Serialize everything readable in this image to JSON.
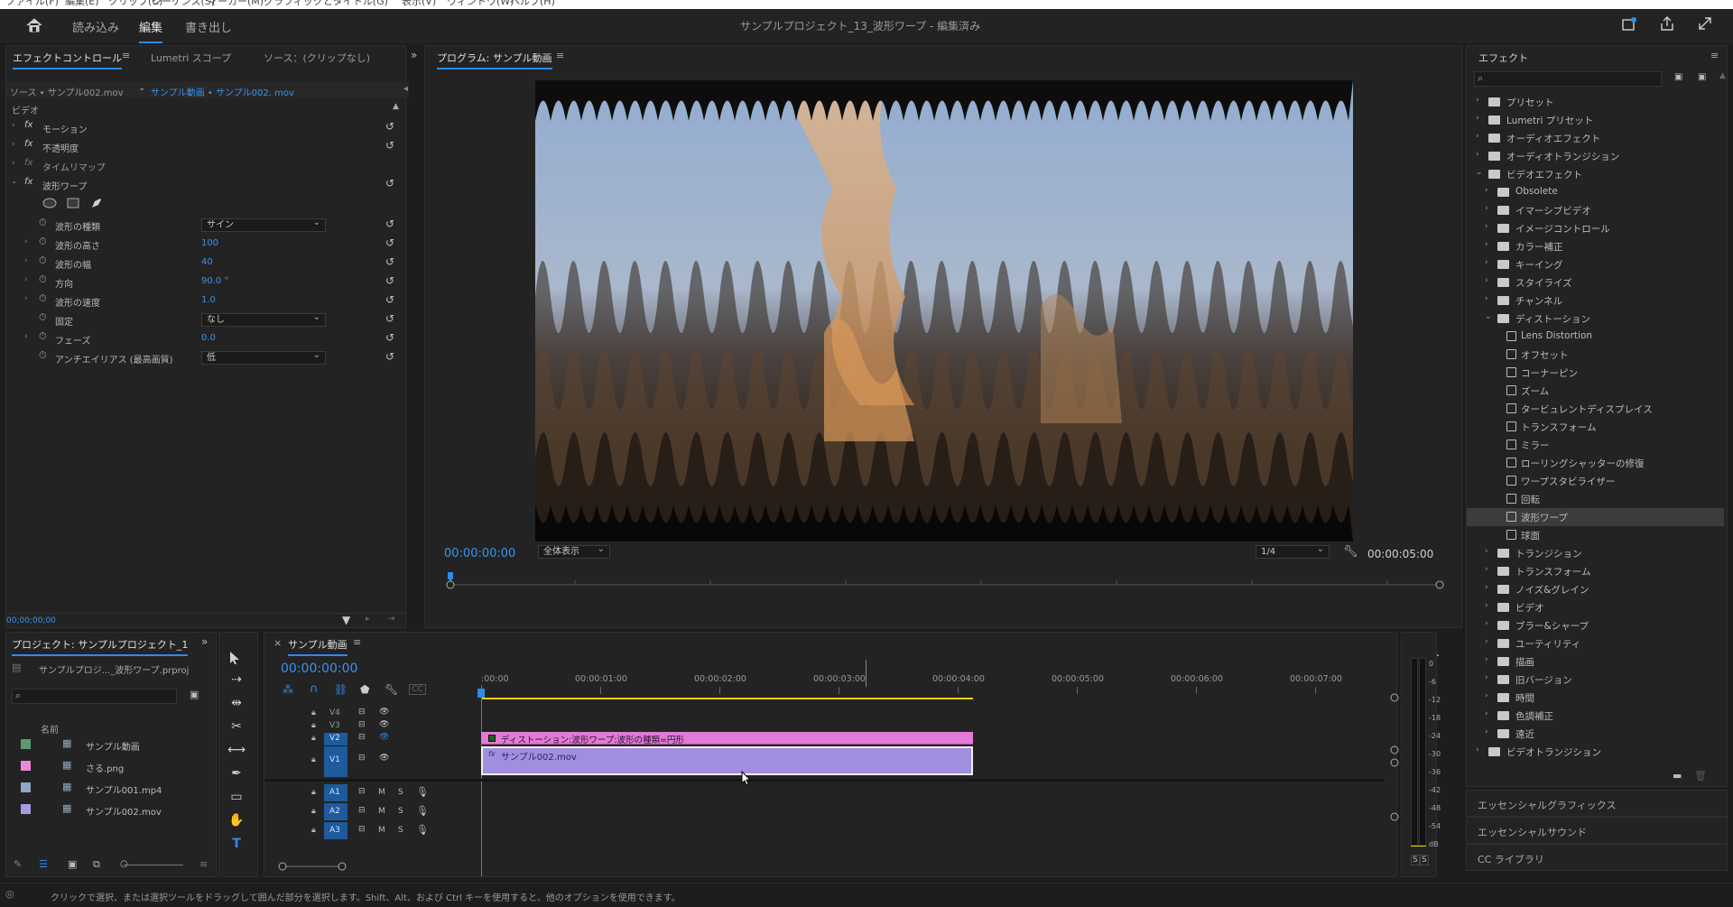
{
  "app": {
    "window_title": "サンプルプロジェクト_13_波形ワープ - 編集済み",
    "menu": [
      "ファイル(F)",
      "編集(E)",
      "クリップ(C)",
      "シーケンス(S)",
      "マーカー(M)",
      "グラフィックとタイトル(G)",
      "表示(V)",
      "ウィンドウ(W)",
      "ヘルプ(H)"
    ],
    "workspaces": [
      "読み込み",
      "編集",
      "書き出し"
    ],
    "active_workspace": "編集"
  },
  "effect_controls": {
    "tabs": [
      "エフェクトコントロール",
      "Lumetri スコープ",
      "ソース：(クリップなし)"
    ],
    "source_label": "ソース • サンプル002.mov",
    "target_label": "サンプル動画 • サンプル002. mov",
    "section": "ビデオ",
    "effects": [
      "モーション",
      "不透明度",
      "タイムリマップ",
      "波形ワープ"
    ],
    "params": [
      {
        "name": "波形の種類",
        "value": "サイン",
        "kind": "dropdown"
      },
      {
        "name": "波形の高さ",
        "value": "100",
        "kind": "number"
      },
      {
        "name": "波形の幅",
        "value": "40",
        "kind": "number"
      },
      {
        "name": "方向",
        "value": "90.0 °",
        "kind": "number"
      },
      {
        "name": "波形の速度",
        "value": "1.0",
        "kind": "number"
      },
      {
        "name": "固定",
        "value": "なし",
        "kind": "dropdown"
      },
      {
        "name": "フェーズ",
        "value": "0.0",
        "kind": "number"
      },
      {
        "name": "アンチエイリアス (最高画質)",
        "value": "低",
        "kind": "dropdown"
      }
    ],
    "footer_timecode": "00;00;00;00"
  },
  "program": {
    "title": "プログラム: サンプル動画",
    "timecode": "00:00:00:00",
    "zoom": "全体表示",
    "resolution": "1/4",
    "duration": "00:00:05:00"
  },
  "project": {
    "title": "プロジェクト: サンプルプロジェクト_1",
    "file": "サンプルプロジ..._波形ワープ.prproj",
    "column_name": "名前",
    "items": [
      {
        "name": "サンプル動画",
        "color": "#5c9a70",
        "icon": "sequence-icon"
      },
      {
        "name": "さる.png",
        "color": "#e88ad8",
        "icon": "image-icon"
      },
      {
        "name": "サンプル001.mp4",
        "color": "#8fa8c4",
        "icon": "video-icon"
      },
      {
        "name": "サンプル002.mov",
        "color": "#a898e0",
        "icon": "video-icon"
      }
    ]
  },
  "timeline": {
    "tab": "サンプル動画",
    "timecode": "00:00:00:00",
    "ruler": [
      ":00:00",
      "00:00:01:00",
      "00:00:02:00",
      "00:00:03:00",
      "00:00:04:00",
      "00:00:05:00",
      "00:00:06:00",
      "00:00:07:00"
    ],
    "video_tracks": [
      "V4",
      "V3",
      "V2",
      "V1"
    ],
    "audio_tracks": [
      "A1",
      "A2",
      "A3"
    ],
    "audio_buttons": [
      "M",
      "S"
    ],
    "adjustment_clip": "ディストーション:波形ワープ:波形の種類=円形",
    "video_clip": "サンプル002.mov"
  },
  "meter": {
    "scale": [
      "0",
      "-6",
      "-12",
      "-18",
      "-24",
      "-30",
      "-36",
      "-42",
      "-48",
      "-54",
      "dB"
    ],
    "solo": [
      "S",
      "S"
    ]
  },
  "effects_panel": {
    "title": "エフェクト",
    "tree": [
      {
        "label": "プリセット",
        "level": 0,
        "type": "folder-special",
        "expanded": false
      },
      {
        "label": "Lumetri プリセット",
        "level": 0,
        "type": "folder-special",
        "expanded": false
      },
      {
        "label": "オーディオエフェクト",
        "level": 0,
        "type": "folder",
        "expanded": false
      },
      {
        "label": "オーディオトランジション",
        "level": 0,
        "type": "folder",
        "expanded": false
      },
      {
        "label": "ビデオエフェクト",
        "level": 0,
        "type": "folder",
        "expanded": true
      },
      {
        "label": "Obsolete",
        "level": 1,
        "type": "folder",
        "expanded": false
      },
      {
        "label": "イマーシブビデオ",
        "level": 1,
        "type": "folder",
        "expanded": false
      },
      {
        "label": "イメージコントロール",
        "level": 1,
        "type": "folder",
        "expanded": false
      },
      {
        "label": "カラー補正",
        "level": 1,
        "type": "folder",
        "expanded": false
      },
      {
        "label": "キーイング",
        "level": 1,
        "type": "folder",
        "expanded": false
      },
      {
        "label": "スタイライズ",
        "level": 1,
        "type": "folder",
        "expanded": false
      },
      {
        "label": "チャンネル",
        "level": 1,
        "type": "folder",
        "expanded": false
      },
      {
        "label": "ディストーション",
        "level": 1,
        "type": "folder",
        "expanded": true
      },
      {
        "label": "Lens Distortion",
        "level": 2,
        "type": "effect"
      },
      {
        "label": "オフセット",
        "level": 2,
        "type": "effect"
      },
      {
        "label": "コーナーピン",
        "level": 2,
        "type": "effect"
      },
      {
        "label": "ズーム",
        "level": 2,
        "type": "effect"
      },
      {
        "label": "タービュレントディスプレイス",
        "level": 2,
        "type": "effect"
      },
      {
        "label": "トランスフォーム",
        "level": 2,
        "type": "effect"
      },
      {
        "label": "ミラー",
        "level": 2,
        "type": "effect"
      },
      {
        "label": "ローリングシャッターの修復",
        "level": 2,
        "type": "effect"
      },
      {
        "label": "ワープスタビライザー",
        "level": 2,
        "type": "effect"
      },
      {
        "label": "回転",
        "level": 2,
        "type": "effect"
      },
      {
        "label": "波形ワープ",
        "level": 2,
        "type": "effect",
        "selected": true
      },
      {
        "label": "球面",
        "level": 2,
        "type": "effect"
      },
      {
        "label": "トランジション",
        "level": 1,
        "type": "folder",
        "expanded": false
      },
      {
        "label": "トランスフォーム",
        "level": 1,
        "type": "folder",
        "expanded": false
      },
      {
        "label": "ノイズ&グレイン",
        "level": 1,
        "type": "folder",
        "expanded": false
      },
      {
        "label": "ビデオ",
        "level": 1,
        "type": "folder",
        "expanded": false
      },
      {
        "label": "ブラー&シャープ",
        "level": 1,
        "type": "folder",
        "expanded": false
      },
      {
        "label": "ユーティリティ",
        "level": 1,
        "type": "folder",
        "expanded": false
      },
      {
        "label": "描画",
        "level": 1,
        "type": "folder",
        "expanded": false
      },
      {
        "label": "旧バージョン",
        "level": 1,
        "type": "folder",
        "expanded": false
      },
      {
        "label": "時間",
        "level": 1,
        "type": "folder",
        "expanded": false
      },
      {
        "label": "色調補正",
        "level": 1,
        "type": "folder",
        "expanded": false
      },
      {
        "label": "遠近",
        "level": 1,
        "type": "folder",
        "expanded": false
      },
      {
        "label": "ビデオトランジション",
        "level": 0,
        "type": "folder",
        "expanded": false
      }
    ],
    "sub_panels": [
      "エッセンシャルグラフィックス",
      "エッセンシャルサウンド",
      "CC ライブラリ"
    ]
  },
  "status_bar": "クリックで選択、または選択ツールをドラッグして囲んだ部分を選択します。Shift、Alt、および Ctrl キーを使用すると、他のオプションを使用できます。",
  "colors": {
    "accent": "#2d8ceb",
    "adjustment_clip": "#e27ad8",
    "video_clip": "#a28ee0"
  }
}
